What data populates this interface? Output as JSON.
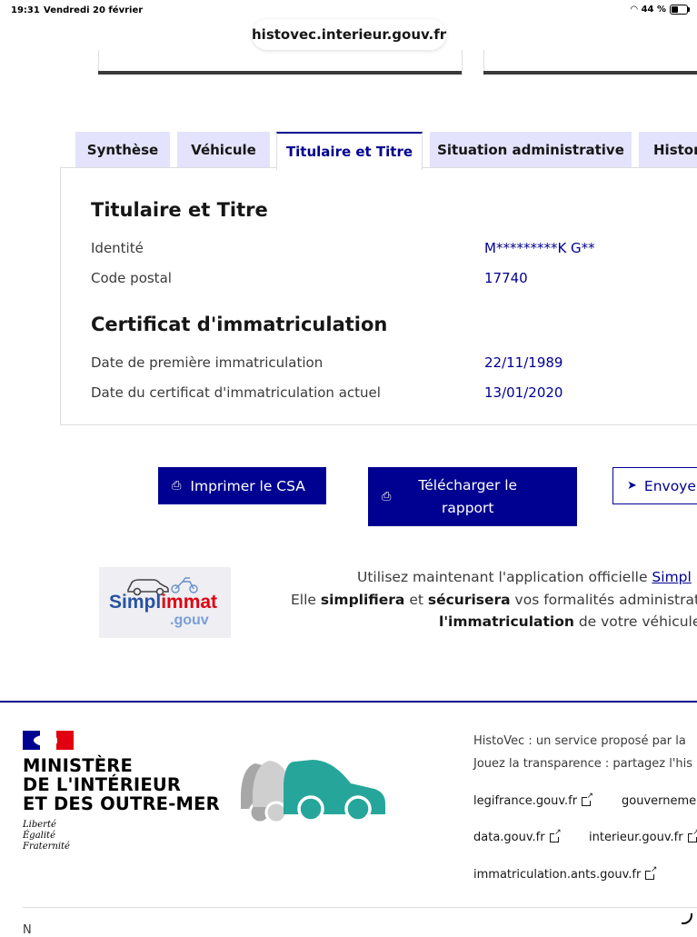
{
  "status_bar": {
    "time": "19:31",
    "date": "Vendredi 20 février",
    "battery": "44 %"
  },
  "browser": {
    "url": "histovec.interieur.gouv.fr"
  },
  "tabs": [
    {
      "label": "Synthèse"
    },
    {
      "label": "Véhicule"
    },
    {
      "label": "Titulaire et Titre"
    },
    {
      "label": "Situation administrative"
    },
    {
      "label": "Histor"
    }
  ],
  "active_tab": "Titulaire et Titre",
  "panel": {
    "section1_title": "Titulaire et Titre",
    "identity_label": "Identité",
    "identity_value": "M*********K G**",
    "postal_label": "Code postal",
    "postal_value": "17740",
    "section2_title": "Certificat d'immatriculation",
    "first_reg_label": "Date de première immatriculation",
    "first_reg_value": "22/11/1989",
    "current_cert_label": "Date du certificat d'immatriculation actuel",
    "current_cert_value": "13/01/2020"
  },
  "actions": {
    "print_label": "Imprimer le CSA",
    "download_line1": "Télécharger le",
    "download_line2": "rapport",
    "send_label": "Envoye"
  },
  "promo": {
    "logo_text_a": "Simpl",
    "logo_text_b": "immat",
    "logo_text_c": ".gouv",
    "line1_prefix": "Utilisez maintenant l'application officielle ",
    "line1_link": "Simpl",
    "line2_a": "Elle ",
    "line2_b": "simplifiera",
    "line2_c": " et ",
    "line2_d": "sécurisera",
    "line2_e": " vos formalités administrative",
    "line3_a": "l'immatriculation",
    "line3_b": " de votre véhicule."
  },
  "footer": {
    "ministry_line1": "MINISTÈRE",
    "ministry_line2": "DE L'INTÉRIEUR",
    "ministry_line3": "ET DES OUTRE-MER",
    "devise1": "Liberté",
    "devise2": "Égalité",
    "devise3": "Fraternité",
    "desc1": "HistoVec : un service proposé par la",
    "desc2": "Jouez la transparence : partagez l'his",
    "links": [
      "legifrance.gouv.fr",
      "gouverneme",
      "data.gouv.fr",
      "interieur.gouv.fr",
      "immatriculation.ants.gouv.fr"
    ],
    "bottom_partial": "N"
  },
  "colors": {
    "primary": "#000091",
    "tab_bg": "#e3e3fd",
    "logo_teal": "#26a69a",
    "marianne_red": "#e1000f"
  }
}
